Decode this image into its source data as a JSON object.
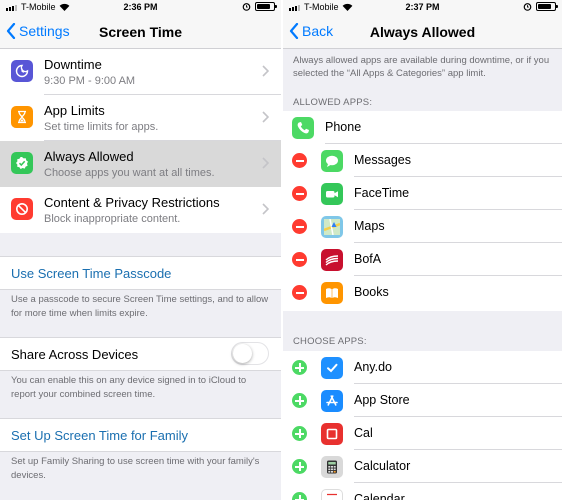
{
  "colors": {
    "ios_blue": "#007aff",
    "link_blue": "#1a6fb0",
    "delete_red": "#ff3b30",
    "add_green": "#4cd964",
    "downtime_purple": "#5856d6",
    "app_limits_orange": "#ff9500",
    "always_allowed_green": "#34c759",
    "restrictions_red": "#ff3b30"
  },
  "left": {
    "status": {
      "carrier": "T-Mobile",
      "time": "2:36 PM",
      "battery_level": 0.85
    },
    "nav": {
      "back_label": "Settings",
      "title": "Screen Time"
    },
    "menu": [
      {
        "title": "Downtime",
        "subtitle": "9:30 PM - 9:00 AM",
        "icon": "moon-clock-icon",
        "color": "#5856d6"
      },
      {
        "title": "App Limits",
        "subtitle": "Set time limits for apps.",
        "icon": "hourglass-icon",
        "color": "#ff9500"
      },
      {
        "title": "Always Allowed",
        "subtitle": "Choose apps you want at all times.",
        "icon": "checkmark-badge-icon",
        "color": "#34c759",
        "selected": true
      },
      {
        "title": "Content & Privacy Restrictions",
        "subtitle": "Block inappropriate content.",
        "icon": "no-entry-icon",
        "color": "#ff3b30"
      }
    ],
    "passcode": {
      "label": "Use Screen Time Passcode",
      "footer": "Use a passcode to secure Screen Time settings, and to allow for more time when limits expire."
    },
    "share": {
      "label": "Share Across Devices",
      "enabled": false,
      "footer": "You can enable this on any device signed in to iCloud to report your combined screen time."
    },
    "family": {
      "label": "Set Up Screen Time for Family",
      "footer": "Set up Family Sharing to use screen time with your family's devices."
    }
  },
  "right": {
    "status": {
      "carrier": "T-Mobile",
      "time": "2:37 PM",
      "battery_level": 0.85
    },
    "nav": {
      "back_label": "Back",
      "title": "Always Allowed"
    },
    "description": "Always allowed apps are available during downtime, or if you selected the “All Apps & Categories” app limit.",
    "allowed_header": "ALLOWED APPS:",
    "allowed_apps": [
      {
        "name": "Phone",
        "icon": "phone-icon",
        "color": "#4cd964",
        "removable": false
      },
      {
        "name": "Messages",
        "icon": "messages-icon",
        "color": "#4cd964",
        "removable": true
      },
      {
        "name": "FaceTime",
        "icon": "facetime-icon",
        "color": "#34c759",
        "removable": true
      },
      {
        "name": "Maps",
        "icon": "maps-icon",
        "color": "#7fc7e8",
        "removable": true
      },
      {
        "name": "BofA",
        "icon": "bofa-icon",
        "color": "#c8102e",
        "removable": true
      },
      {
        "name": "Books",
        "icon": "books-icon",
        "color": "#ff9500",
        "removable": true
      }
    ],
    "choose_header": "CHOOSE APPS:",
    "choose_apps": [
      {
        "name": "Any.do",
        "icon": "anydo-icon",
        "color": "#1e90ff"
      },
      {
        "name": "App Store",
        "icon": "app-store-icon",
        "color": "#1a8cff"
      },
      {
        "name": "Cal",
        "icon": "cal-icon",
        "color": "#e8312f"
      },
      {
        "name": "Calculator",
        "icon": "calculator-icon",
        "color": "#d9d9d9"
      },
      {
        "name": "Calendar",
        "icon": "calendar-icon",
        "color": "#ffffff"
      }
    ]
  }
}
